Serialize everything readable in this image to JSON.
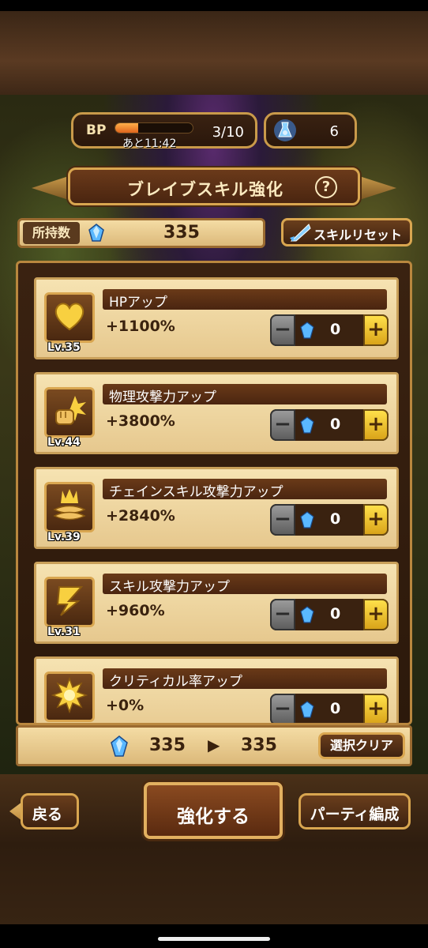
{
  "header": {
    "bp_label": "BP",
    "bp_timer": "あと11:42",
    "bp_count": "3/10",
    "bp_progress": 0.3,
    "item_count": "6"
  },
  "title": {
    "text": "ブレイブスキル強化",
    "help": "?"
  },
  "owned": {
    "label": "所持数",
    "value": "335"
  },
  "reset_button": {
    "label": "スキルリセット"
  },
  "skills": [
    {
      "name": "HPアップ",
      "effect": "+1100%",
      "level": "Lv.35",
      "points": "0",
      "icon": "heart-icon"
    },
    {
      "name": "物理攻撃力アップ",
      "effect": "+3800%",
      "level": "Lv.44",
      "points": "0",
      "icon": "fist-icon"
    },
    {
      "name": "チェインスキル攻撃力アップ",
      "effect": "+2840%",
      "level": "Lv.39",
      "points": "0",
      "icon": "chain-skill-icon"
    },
    {
      "name": "スキル攻撃力アップ",
      "effect": "+960%",
      "level": "Lv.31",
      "points": "0",
      "icon": "lightning-icon"
    },
    {
      "name": "クリティカル率アップ",
      "effect": "+0%",
      "level": "",
      "points": "0",
      "icon": "burst-icon"
    }
  ],
  "stepper": {
    "minus": "−",
    "plus": "+"
  },
  "summary": {
    "from": "335",
    "arrow": "▶",
    "to": "335",
    "clear_label": "選択クリア"
  },
  "footer": {
    "back_label": "戻る",
    "enhance_label": "強化する",
    "party_label": "パーティ編成"
  },
  "colors": {
    "gem": "#5ab8ff",
    "accent_gold": "#d9a650",
    "panel_brown": "#3a2211"
  }
}
